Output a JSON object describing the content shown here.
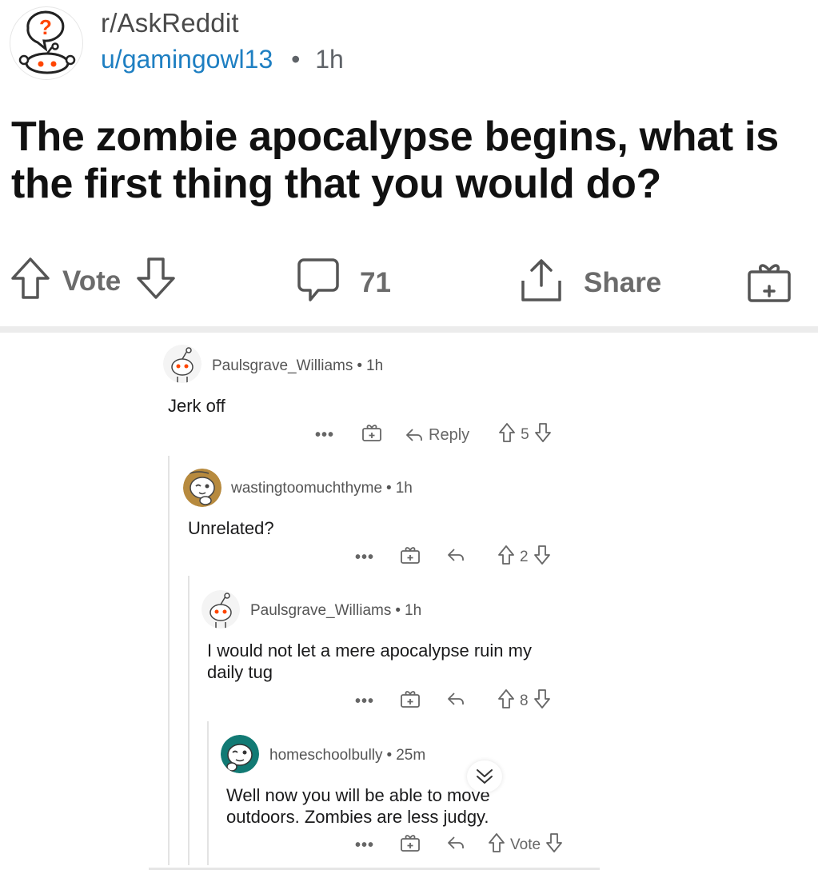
{
  "post": {
    "subreddit": "r/AskReddit",
    "author": "u/gamingowl13",
    "separator": "•",
    "age": "1h",
    "title": "The zombie apocalypse begins, what is the first thing that you would do?"
  },
  "actions": {
    "vote_label": "Vote",
    "comment_count": "71",
    "share_label": "Share"
  },
  "comments": [
    {
      "username": "Paulsgrave_Williams",
      "separator": "•",
      "age": "1h",
      "body": "Jerk off",
      "more": "•••",
      "reply_label": "Reply",
      "score": "5"
    },
    {
      "username": "wastingtoomuchthyme",
      "separator": "•",
      "age": "1h",
      "body": "Unrelated?",
      "more": "•••",
      "score": "2"
    },
    {
      "username": "Paulsgrave_Williams",
      "separator": "•",
      "age": "1h",
      "body": "I would not let a mere apocalypse ruin my daily tug",
      "more": "•••",
      "score": "8"
    },
    {
      "username": "homeschoolbully",
      "separator": "•",
      "age": "25m",
      "body": "Well now you will be able to move outdoors. Zombies are less judgy.",
      "more": "•••",
      "score": "Vote"
    }
  ],
  "icons": {
    "subreddit_avatar": "question-snoo-icon",
    "upvote": "arrow-up-icon",
    "downvote": "arrow-down-icon",
    "comment": "speech-bubble-icon",
    "share": "share-icon",
    "award": "gift-icon",
    "reply": "reply-arrow-icon",
    "collapse": "double-chevron-down-icon"
  },
  "colors": {
    "link_blue": "#1e7fc2",
    "snoo_orange": "#ff4500",
    "muted_gray": "#6b6b6b"
  }
}
